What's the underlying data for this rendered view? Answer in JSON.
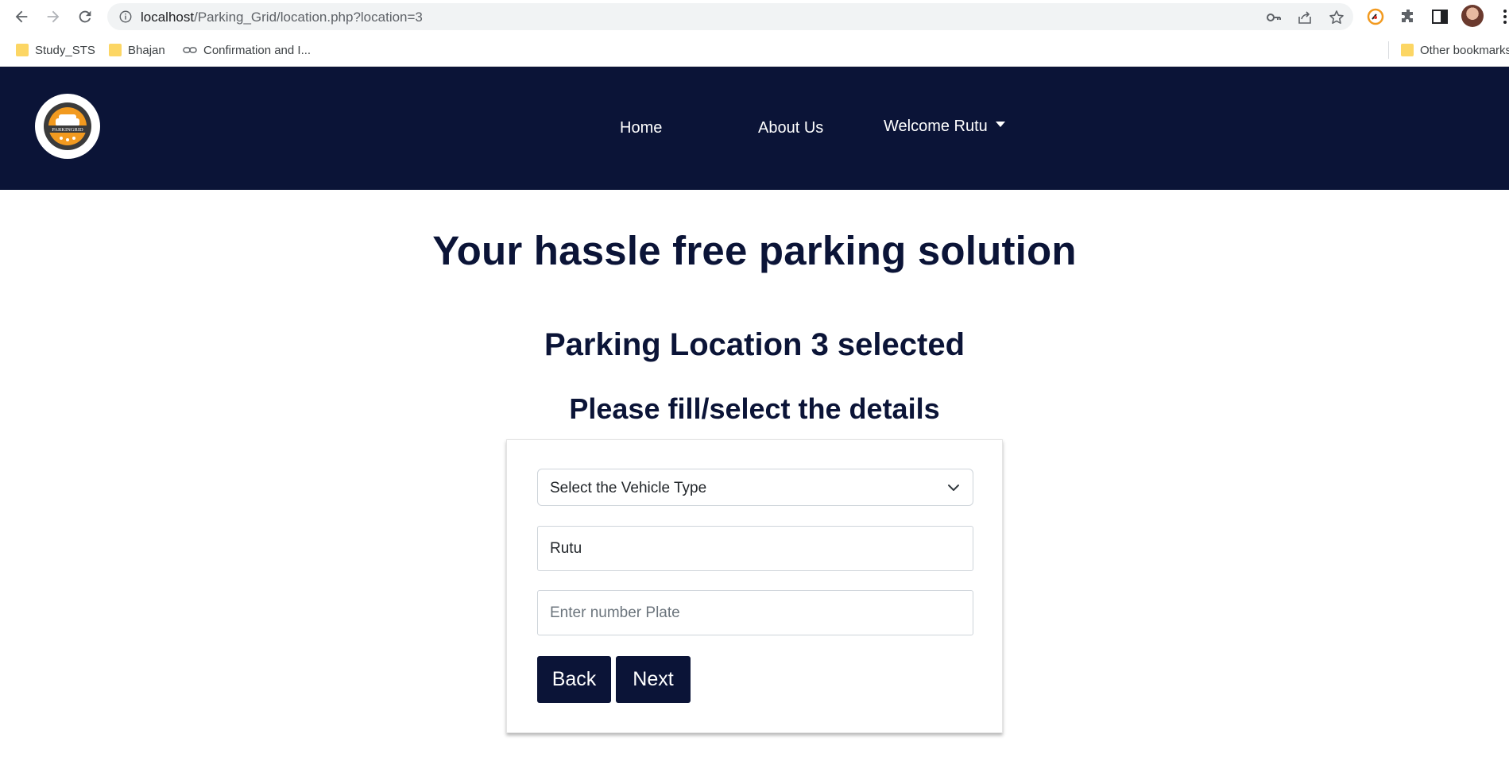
{
  "browser": {
    "url_host": "localhost",
    "url_path": "/Parking_Grid/location.php?location=3",
    "bookmarks": [
      {
        "label": "Study_STS",
        "icon": "folder-icon"
      },
      {
        "label": "Bhajan",
        "icon": "folder-icon"
      },
      {
        "label": "Confirmation and I...",
        "icon": "link-icon"
      }
    ],
    "other_bookmarks": "Other bookmarks"
  },
  "header": {
    "logo_text": "PARKINGRID",
    "nav": {
      "home": "Home",
      "about": "About Us",
      "welcome": "Welcome Rutu"
    }
  },
  "main": {
    "hero_title": "Your hassle free parking solution",
    "location_title": "Parking Location 3 selected",
    "instruction": "Please fill/select the details",
    "form": {
      "vehicle_select_value": "Select the Vehicle Type",
      "name_value": "Rutu",
      "plate_placeholder": "Enter number Plate",
      "back_label": "Back",
      "next_label": "Next"
    }
  },
  "colors": {
    "navy": "#0b1437",
    "chrome_bg": "#f1f3f4",
    "logo_orange": "#f29a1f"
  }
}
